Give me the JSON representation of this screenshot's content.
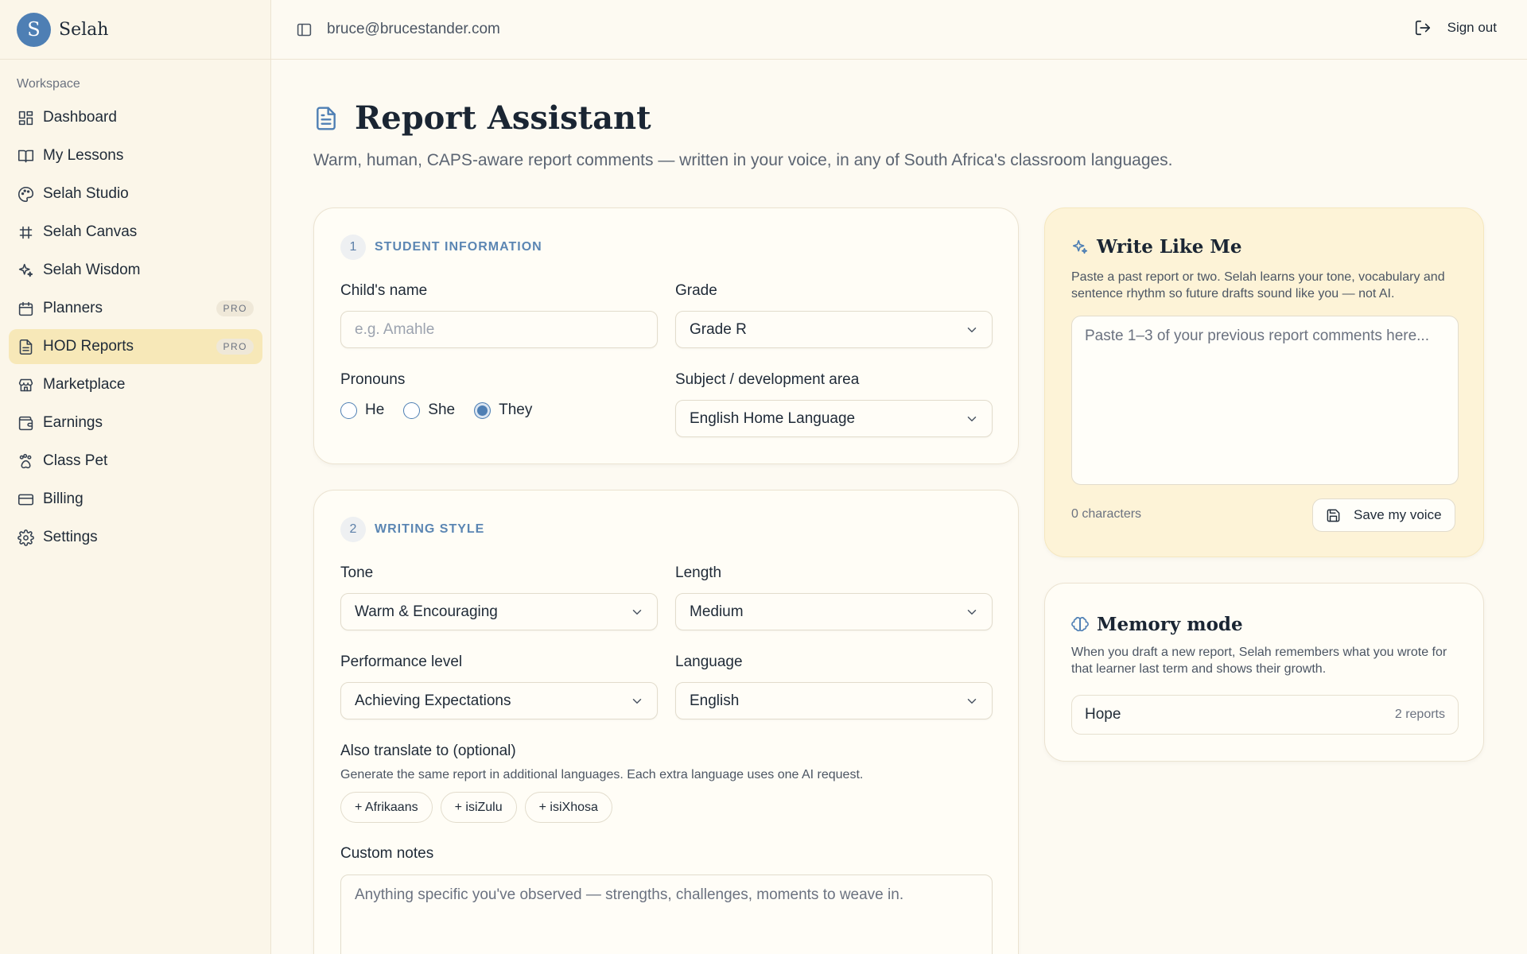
{
  "brand": {
    "logo_letter": "S",
    "name": "Selah"
  },
  "sidebar": {
    "section_label": "Workspace",
    "items": [
      {
        "label": "Dashboard",
        "icon": "dashboard-icon"
      },
      {
        "label": "My Lessons",
        "icon": "book-icon"
      },
      {
        "label": "Selah Studio",
        "icon": "palette-icon"
      },
      {
        "label": "Selah Canvas",
        "icon": "grid-frame-icon"
      },
      {
        "label": "Selah Wisdom",
        "icon": "sparkles-icon"
      },
      {
        "label": "Planners",
        "icon": "calendar-icon",
        "badge": "PRO"
      },
      {
        "label": "HOD Reports",
        "icon": "document-icon",
        "badge": "PRO",
        "active": true
      },
      {
        "label": "Marketplace",
        "icon": "store-icon"
      },
      {
        "label": "Earnings",
        "icon": "wallet-icon"
      },
      {
        "label": "Class Pet",
        "icon": "paw-icon"
      },
      {
        "label": "Billing",
        "icon": "credit-card-icon"
      },
      {
        "label": "Settings",
        "icon": "gear-icon"
      }
    ]
  },
  "topbar": {
    "email": "bruce@brucestander.com",
    "sign_out": "Sign out"
  },
  "page": {
    "title": "Report Assistant",
    "subtitle": "Warm, human, CAPS-aware report comments — written in your voice, in any of South Africa's classroom languages."
  },
  "student_info": {
    "step": "1",
    "title": "STUDENT INFORMATION",
    "child_name_label": "Child's name",
    "child_name_placeholder": "e.g. Amahle",
    "grade_label": "Grade",
    "grade_value": "Grade R",
    "pronouns_label": "Pronouns",
    "pronouns": [
      "He",
      "She",
      "They"
    ],
    "pronoun_selected": "They",
    "subject_label": "Subject / development area",
    "subject_value": "English Home Language"
  },
  "writing_style": {
    "step": "2",
    "title": "WRITING STYLE",
    "tone_label": "Tone",
    "tone_value": "Warm & Encouraging",
    "length_label": "Length",
    "length_value": "Medium",
    "performance_label": "Performance level",
    "performance_value": "Achieving Expectations",
    "language_label": "Language",
    "language_value": "English",
    "translate_label": "Also translate to (optional)",
    "translate_help": "Generate the same report in additional languages. Each extra language uses one AI request.",
    "translate_options": [
      "+ Afrikaans",
      "+ isiZulu",
      "+ isiXhosa"
    ],
    "notes_label": "Custom notes",
    "notes_placeholder": "Anything specific you've observed — strengths, challenges, moments to weave in."
  },
  "write_like_me": {
    "title": "Write Like Me",
    "description": "Paste a past report or two. Selah learns your tone, vocabulary and sentence rhythm so future drafts sound like you — not AI.",
    "placeholder": "Paste 1–3 of your previous report comments here...",
    "char_count": "0 characters",
    "save_label": "Save my voice"
  },
  "memory_mode": {
    "title": "Memory mode",
    "description": "When you draft a new report, Selah remembers what you wrote for that learner last term and shows their growth.",
    "learners": [
      {
        "name": "Hope",
        "count": "2 reports"
      }
    ]
  },
  "colors": {
    "accent": "#4e7fb4",
    "background": "#fdfaf2",
    "sidebar": "#fbf6e9",
    "highlight": "#f7e8b8",
    "warm_card": "#fdf3d7"
  }
}
